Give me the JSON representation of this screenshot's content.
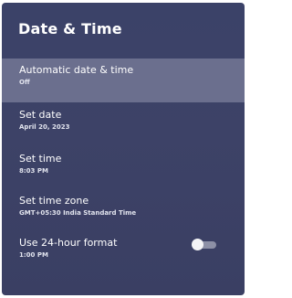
{
  "header": {
    "title": "Date & Time"
  },
  "items": [
    {
      "title": "Automatic date & time",
      "value": "Off"
    },
    {
      "title": "Set date",
      "value": "April 20, 2023"
    },
    {
      "title": "Set time",
      "value": "8:03 PM"
    },
    {
      "title": "Set time zone",
      "value": "GMT+05:30 India Standard Time"
    },
    {
      "title": "Use 24-hour format",
      "value": "1:00 PM",
      "toggle": "off"
    }
  ]
}
